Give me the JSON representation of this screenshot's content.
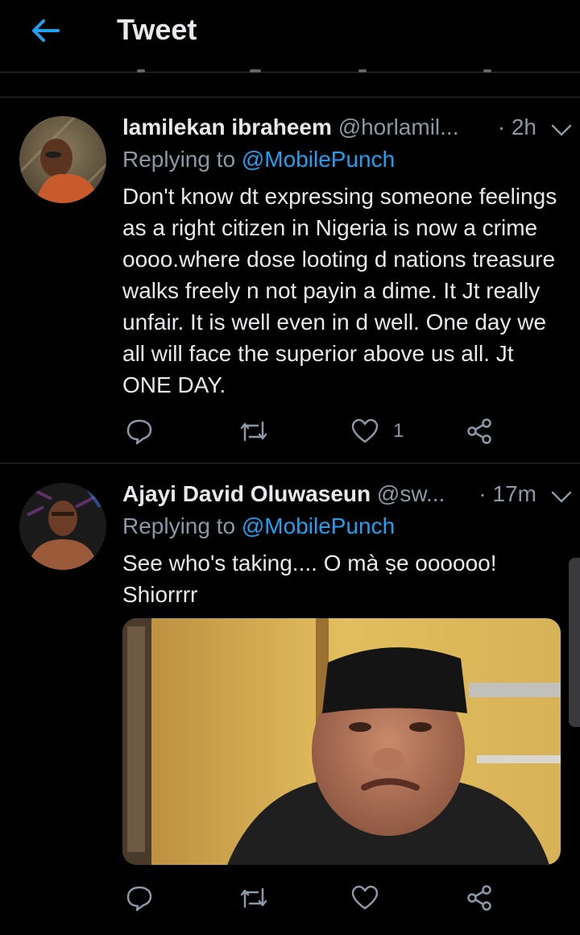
{
  "header": {
    "title": "Tweet",
    "back_label": "back"
  },
  "tweets": [
    {
      "name": "lamilekan ibraheem",
      "handle": "@horlamil...",
      "time": "· 2h",
      "replying_prefix": "Replying to",
      "replying_mention": "@MobilePunch",
      "text": "Don't know dt expressing someone feelings as a right citizen in Nigeria is now a crime oooo.where dose looting d nations treasure walks freely n not payin a dime. It Jt really unfair. It is well even in d well. One day we all will face the superior above us all. Jt ONE DAY.",
      "likes": "1"
    },
    {
      "name": "Ajayi David Oluwaseun",
      "handle": "@sw...",
      "time": "· 17m",
      "replying_prefix": "Replying to",
      "replying_mention": "@MobilePunch",
      "text": "See who's taking.... O mà ṣe oooooo! Shiorrrr",
      "likes": ""
    }
  ],
  "colors": {
    "background": "#000000",
    "accent": "#1da1f2",
    "secondary_text": "#8b98a5",
    "divider": "#2f3336"
  },
  "icons": {
    "back": "arrow-left-icon",
    "caret": "chevron-down-icon",
    "reply": "comment-icon",
    "retweet": "retweet-icon",
    "like": "heart-icon",
    "share": "share-icon"
  }
}
